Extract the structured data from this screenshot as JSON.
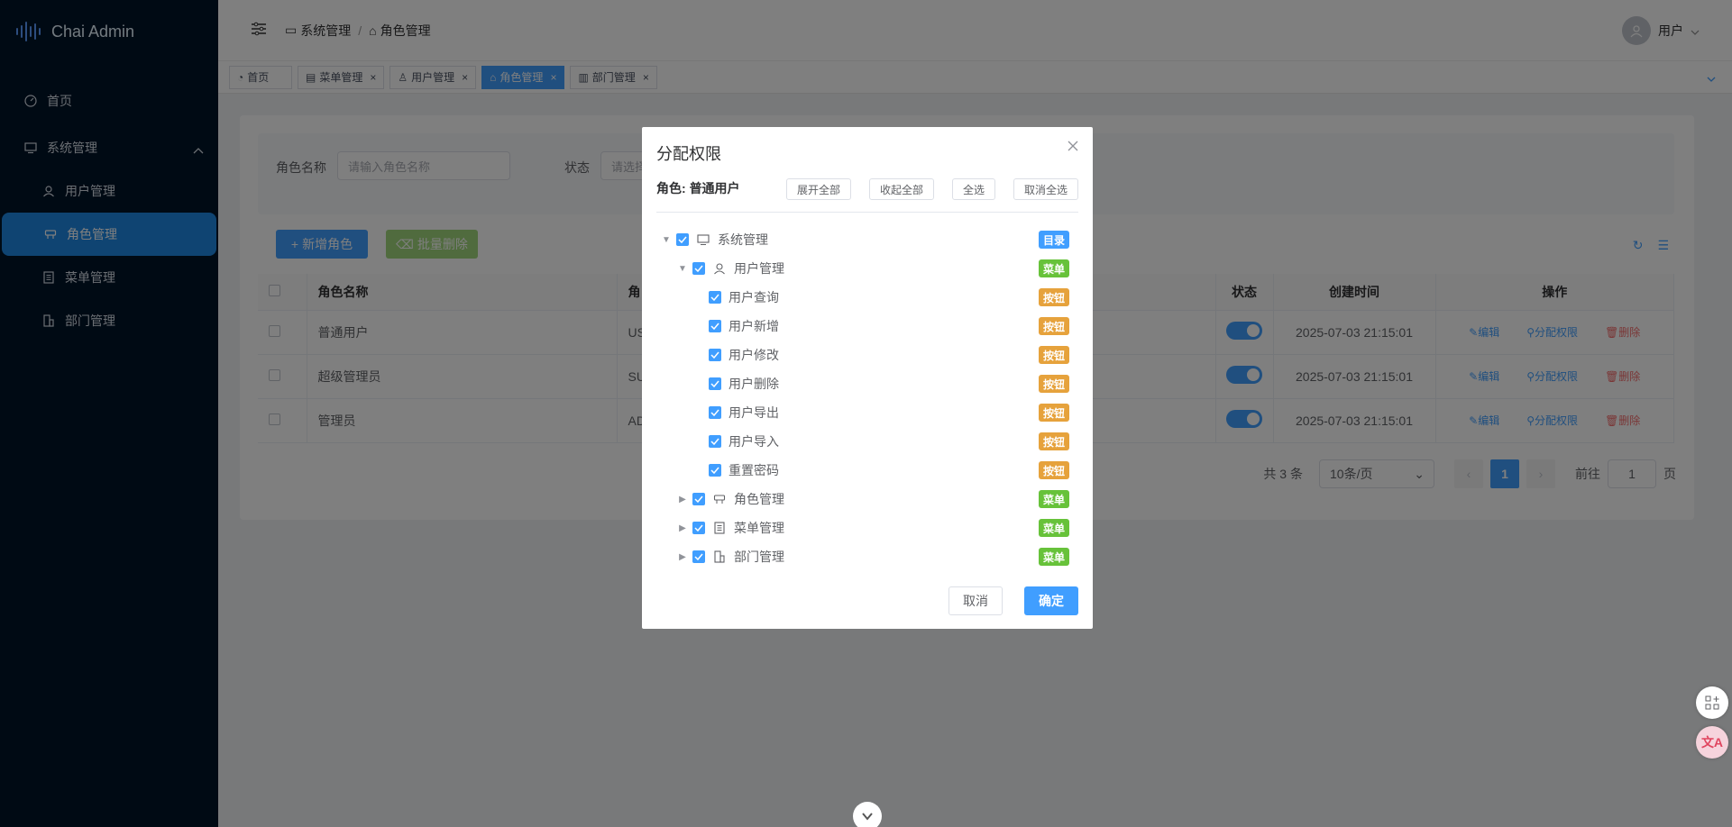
{
  "app": {
    "title": "Chai Admin"
  },
  "sidebar": {
    "items": [
      {
        "label": "首页",
        "icon": "dashboard-icon"
      },
      {
        "label": "系统管理",
        "icon": "monitor-icon"
      },
      {
        "label": "用户管理",
        "icon": "user-icon"
      },
      {
        "label": "角色管理",
        "icon": "role-icon"
      },
      {
        "label": "菜单管理",
        "icon": "document-icon"
      },
      {
        "label": "部门管理",
        "icon": "building-icon"
      }
    ]
  },
  "header": {
    "breadcrumb": [
      "系统管理",
      "角色管理"
    ],
    "breadcrumb_sep": "/",
    "user": "用户"
  },
  "tabs": [
    {
      "label": "首页"
    },
    {
      "label": "菜单管理"
    },
    {
      "label": "用户管理"
    },
    {
      "label": "角色管理",
      "active": true
    },
    {
      "label": "部门管理"
    }
  ],
  "search": {
    "role_name_label": "角色名称",
    "role_name_placeholder": "请输入角色名称",
    "status_label": "状态",
    "status_placeholder": "请选择"
  },
  "toolbar": {
    "add_label": "新增角色",
    "batch_delete_label": "批量删除"
  },
  "table": {
    "headers": {
      "name": "角色名称",
      "code": "角",
      "status": "状态",
      "created": "创建时间",
      "ops": "操作"
    },
    "rows": [
      {
        "name": "普通用户",
        "code": "US",
        "created": "2025-07-03 21:15:01"
      },
      {
        "name": "超级管理员",
        "code": "SU",
        "created": "2025-07-03 21:15:01"
      },
      {
        "name": "管理员",
        "code": "AD",
        "created": "2025-07-03 21:15:01"
      }
    ],
    "ops": {
      "edit": "编辑",
      "assign": "分配权限",
      "delete": "删除"
    }
  },
  "pager": {
    "total": "共 3 条",
    "page_size": "10条/页",
    "current": "1",
    "goto_label": "前往",
    "goto_value": "1",
    "page_suffix": "页"
  },
  "dialog": {
    "title": "分配权限",
    "role_prefix": "角色:",
    "role_name": "普通用户",
    "expand_all": "展开全部",
    "collapse_all": "收起全部",
    "select_all": "全选",
    "deselect_all": "取消全选",
    "tree": [
      {
        "label": "系统管理",
        "tag": "目录"
      },
      {
        "label": "用户管理",
        "tag": "菜单"
      },
      {
        "label": "用户查询",
        "tag": "按钮"
      },
      {
        "label": "用户新增",
        "tag": "按钮"
      },
      {
        "label": "用户修改",
        "tag": "按钮"
      },
      {
        "label": "用户删除",
        "tag": "按钮"
      },
      {
        "label": "用户导出",
        "tag": "按钮"
      },
      {
        "label": "用户导入",
        "tag": "按钮"
      },
      {
        "label": "重置密码",
        "tag": "按钮"
      },
      {
        "label": "角色管理",
        "tag": "菜单"
      },
      {
        "label": "菜单管理",
        "tag": "菜单"
      },
      {
        "label": "部门管理",
        "tag": "菜单"
      }
    ],
    "cancel": "取消",
    "ok": "确定"
  },
  "colors": {
    "primary": "#409eff",
    "success": "#67c23a",
    "warning": "#e6a23c",
    "sidebar": "#001529"
  }
}
